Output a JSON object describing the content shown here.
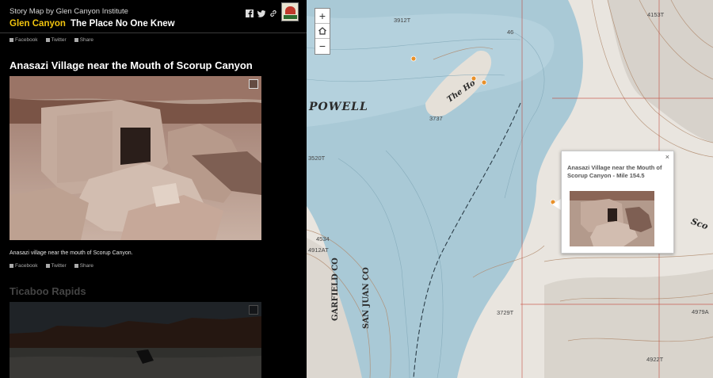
{
  "header": {
    "byline": "Story Map by Glen Canyon Institute",
    "title": "Glen Canyon",
    "subtitle": "The Place No One Knew",
    "icons": [
      "facebook-icon",
      "twitter-icon",
      "link-icon"
    ],
    "logo": "glen-canyon-institute-logo"
  },
  "top_share": {
    "facebook": "Facebook",
    "twitter": "Twitter",
    "share": "Share"
  },
  "section1": {
    "title": "Anasazi Village near the Mouth of Scorup Canyon",
    "caption": "Anasazi village near the mouth of Scorup Canyon.",
    "share": {
      "facebook": "Facebook",
      "twitter": "Twitter",
      "share": "Share"
    }
  },
  "section2": {
    "title": "Ticaboo Rapids"
  },
  "map": {
    "zoom_in": "+",
    "home_icon": "home-icon",
    "zoom_out": "−",
    "labels": {
      "powell": "POWELL",
      "the_ho": "The Ho",
      "sco": "Sco",
      "garfield": "GARFIELD CO",
      "san_juan": "SAN JUAN CO"
    },
    "elevations": [
      "4153T",
      "3912T",
      "3737",
      "3520T",
      "4534",
      "4912AT",
      "3729T",
      "4979A",
      "4922T",
      "46"
    ],
    "popup": {
      "title": "Anasazi Village near the Mouth of Scorup Canyon - Mile 154.5",
      "close": "×"
    }
  },
  "colors": {
    "accent": "#f1c40f",
    "water": "#a9c9d6",
    "marker": "#e8902a"
  }
}
